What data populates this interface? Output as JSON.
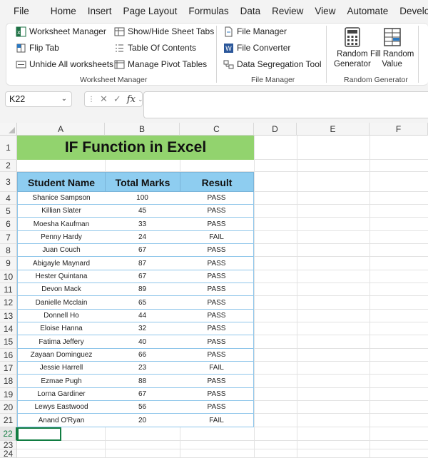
{
  "menu": [
    "File",
    "Home",
    "Insert",
    "Page Layout",
    "Formulas",
    "Data",
    "Review",
    "View",
    "Automate",
    "Developer"
  ],
  "ribbon": {
    "worksheet_manager": {
      "items": [
        "Worksheet Manager",
        "Show/Hide Sheet Tabs",
        "Flip Tab",
        "Table Of Contents",
        "Unhide All worksheets",
        "Manage Pivot Tables"
      ],
      "label": "Worksheet Manager"
    },
    "file_manager": {
      "items": [
        "File Manager",
        "File Converter",
        "Data Segregation Tool"
      ],
      "label": "File Manager"
    },
    "random_generator": {
      "btn1": [
        "Random",
        "Generator"
      ],
      "btn2": [
        "Fill Random",
        "Value"
      ],
      "label": "Random Generator"
    }
  },
  "formula_bar": {
    "name_box": "K22",
    "fx": "fx",
    "value": ""
  },
  "columns": [
    "A",
    "B",
    "C",
    "D",
    "E",
    "F"
  ],
  "rows": [
    "1",
    "2",
    "3",
    "4",
    "5",
    "6",
    "7",
    "8",
    "9",
    "10",
    "11",
    "12",
    "13",
    "14",
    "15",
    "16",
    "17",
    "18",
    "19",
    "20",
    "21",
    "22",
    "23",
    "24"
  ],
  "sheet": {
    "title": "IF Function in Excel",
    "headers": [
      "Student Name",
      "Total Marks",
      "Result"
    ],
    "records": [
      [
        "Shanice Sampson",
        "100",
        "PASS"
      ],
      [
        "Killian Slater",
        "45",
        "PASS"
      ],
      [
        "Moesha Kaufman",
        "33",
        "PASS"
      ],
      [
        "Penny Hardy",
        "24",
        "FAIL"
      ],
      [
        "Juan Couch",
        "67",
        "PASS"
      ],
      [
        "Abigayle Maynard",
        "87",
        "PASS"
      ],
      [
        "Hester Quintana",
        "67",
        "PASS"
      ],
      [
        "Devon Mack",
        "89",
        "PASS"
      ],
      [
        "Danielle Mcclain",
        "65",
        "PASS"
      ],
      [
        "Donnell Ho",
        "44",
        "PASS"
      ],
      [
        "Eloise Hanna",
        "32",
        "PASS"
      ],
      [
        "Fatima Jeffery",
        "40",
        "PASS"
      ],
      [
        "Zayaan Dominguez",
        "66",
        "PASS"
      ],
      [
        "Jessie Harrell",
        "23",
        "FAIL"
      ],
      [
        "Ezmae Pugh",
        "88",
        "PASS"
      ],
      [
        "Lorna Gardiner",
        "67",
        "PASS"
      ],
      [
        "Lewys Eastwood",
        "56",
        "PASS"
      ],
      [
        "Anand O'Ryan",
        "20",
        "FAIL"
      ]
    ]
  },
  "active_row": "22",
  "colors": {
    "title_fill": "#92d36e",
    "header_fill": "#8ecdf0",
    "selection": "#107c41"
  }
}
